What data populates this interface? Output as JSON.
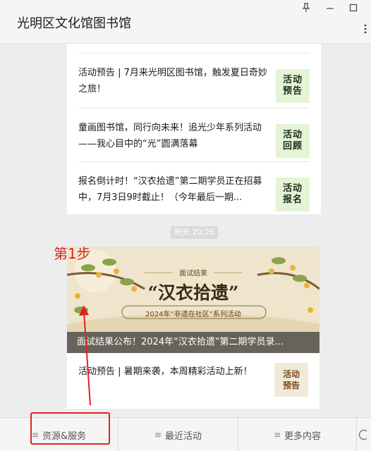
{
  "window": {
    "title": "光明区文化馆图书馆",
    "pin_icon": "pin-icon",
    "minimize_icon": "minimize-icon",
    "maximize_icon": "maximize-icon",
    "more_icon": "more-dots-icon"
  },
  "card1": {
    "items": [
      {
        "text": "活动预告 | 7月来光明区图书馆，触发夏日奇妙之旅！",
        "thumb": "活动预告"
      },
      {
        "text": "童画图书馆，同行向未来！追光少年系列活动——我心目中的“光”圆满落幕",
        "thumb": "活动回顾"
      },
      {
        "text": "报名倒计时！“汉衣拾遗”第二期学员正在招募中，7月3日9时截止！（今年最后一期...",
        "thumb": "活动报名"
      }
    ]
  },
  "timestamp": "昨天 20:26",
  "card2": {
    "banner": {
      "subtitle": "面试结果",
      "title": "“汉衣拾遗”",
      "tagline": "2024年“非遗在社区”系列活动",
      "caption": "面试结果公布！2024年“汉衣拾遗”第二期学员录..."
    },
    "item": {
      "text": "活动预告 | 暑期来袭，本周精彩活动上新！",
      "thumb": "活动预告"
    }
  },
  "annotation": {
    "step_label": "第1步",
    "color": "#e0241a"
  },
  "menu": {
    "tabs": [
      {
        "label": "资源&服务"
      },
      {
        "label": "最近活动"
      },
      {
        "label": "更多内容"
      }
    ]
  },
  "colors": {
    "background": "#ededed",
    "card": "#ffffff",
    "thumb_green": "#e4f4d6"
  }
}
